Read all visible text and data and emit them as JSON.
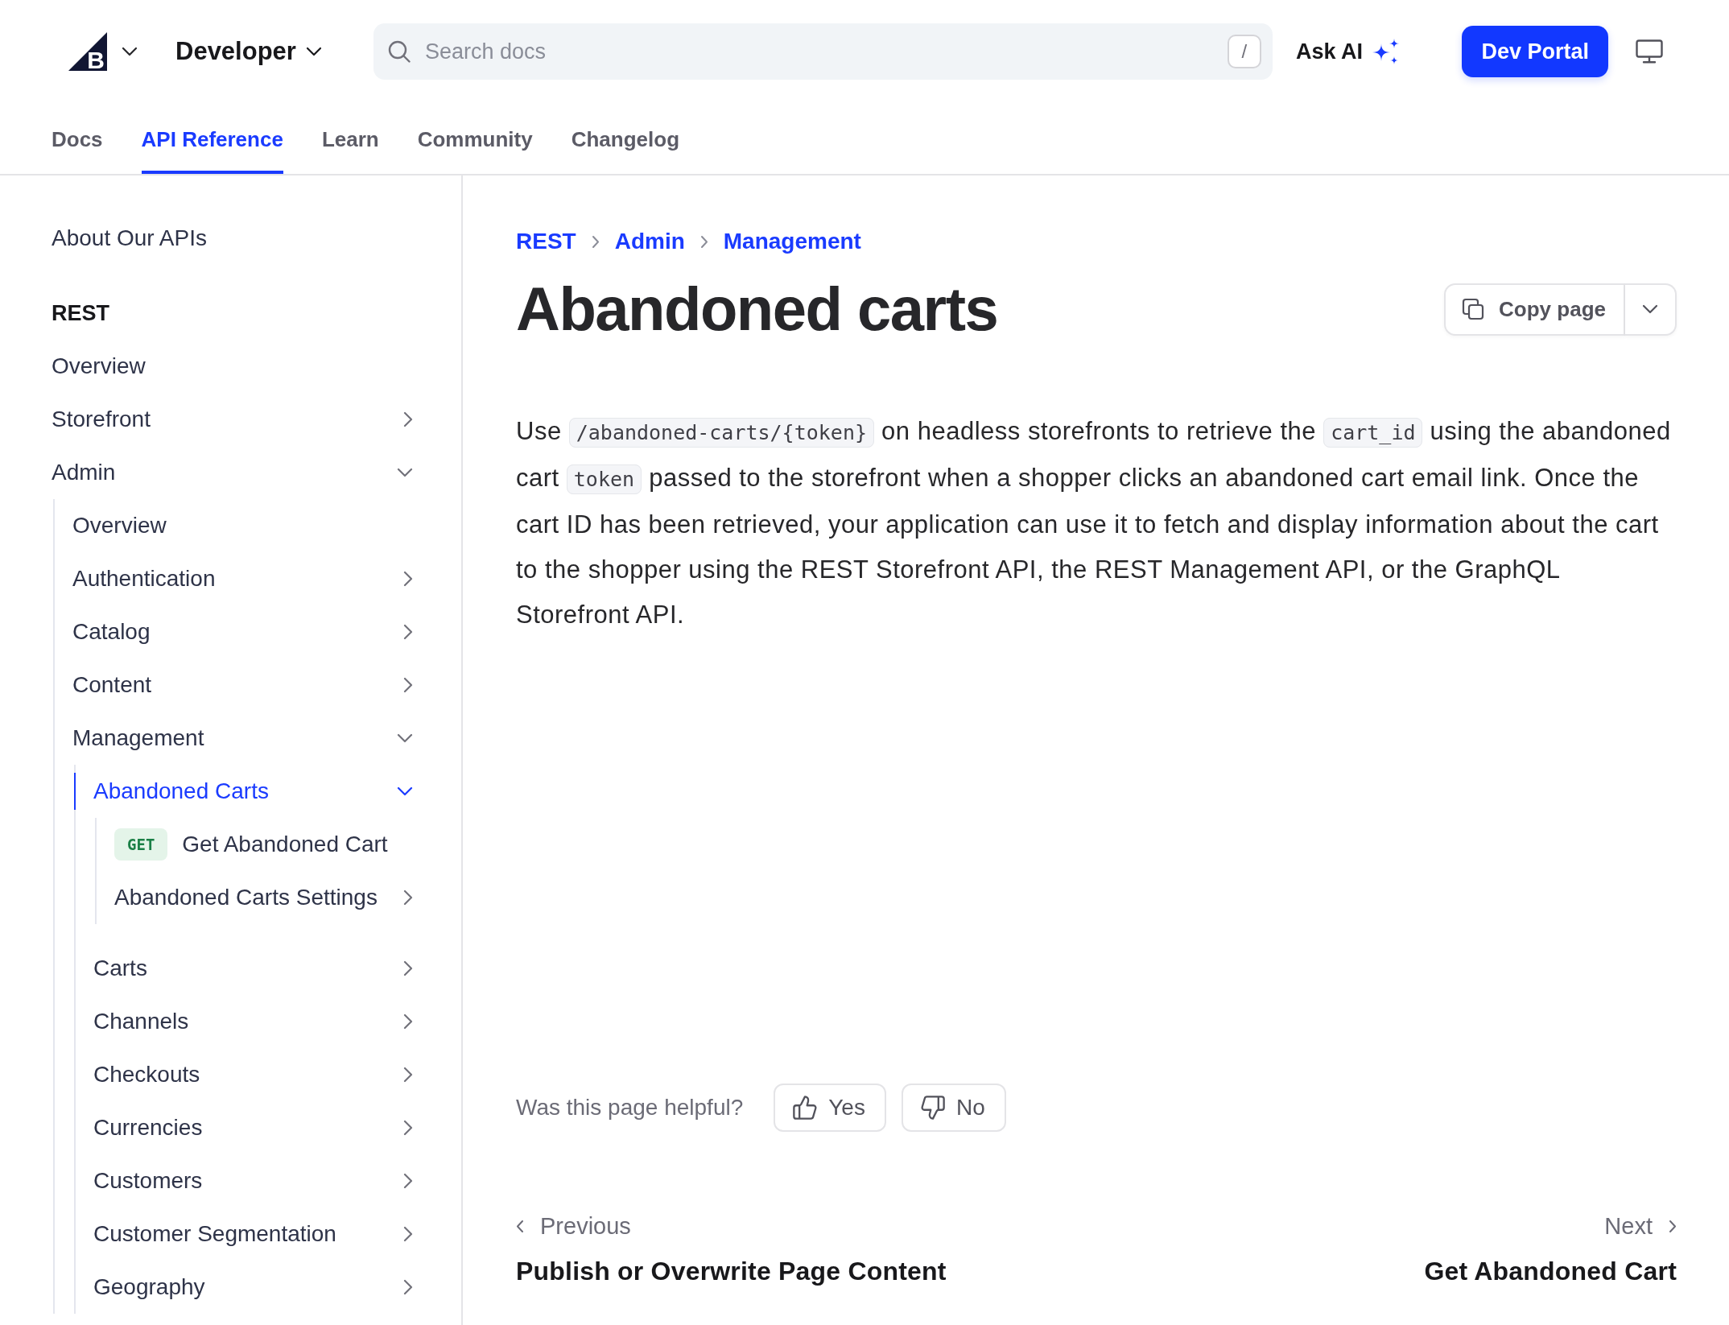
{
  "header": {
    "brand": {
      "letter": "B"
    },
    "product": "Developer",
    "search": {
      "placeholder": "Search docs",
      "shortcut": "/"
    },
    "ask_ai": "Ask AI",
    "dev_portal": "Dev Portal"
  },
  "tabs": [
    {
      "label": "Docs",
      "selected": false
    },
    {
      "label": "API Reference",
      "selected": true
    },
    {
      "label": "Learn",
      "selected": false
    },
    {
      "label": "Community",
      "selected": false
    },
    {
      "label": "Changelog",
      "selected": false
    }
  ],
  "sidebar": {
    "items": [
      {
        "kind": "link",
        "label": "About Our APIs",
        "selected": false
      },
      {
        "kind": "heading",
        "label": "REST"
      },
      {
        "kind": "link",
        "label": "Overview",
        "selected": false
      },
      {
        "kind": "group",
        "label": "Storefront",
        "expanded": false,
        "selected": false
      },
      {
        "kind": "group",
        "label": "Admin",
        "expanded": true,
        "selected": false,
        "children": [
          {
            "kind": "link",
            "label": "Overview",
            "selected": false
          },
          {
            "kind": "group",
            "label": "Authentication",
            "expanded": false,
            "selected": false
          },
          {
            "kind": "group",
            "label": "Catalog",
            "expanded": false,
            "selected": false
          },
          {
            "kind": "group",
            "label": "Content",
            "expanded": false,
            "selected": false
          },
          {
            "kind": "group",
            "label": "Management",
            "expanded": true,
            "selected": false,
            "children": [
              {
                "kind": "group",
                "label": "Abandoned Carts",
                "expanded": true,
                "selected": true,
                "children": [
                  {
                    "kind": "endpoint",
                    "method": "GET",
                    "label": "Get Abandoned Cart",
                    "selected": false
                  },
                  {
                    "kind": "group",
                    "label": "Abandoned Carts Settings",
                    "expanded": false,
                    "selected": false
                  }
                ]
              },
              {
                "kind": "group",
                "label": "Carts",
                "expanded": false,
                "selected": false
              },
              {
                "kind": "group",
                "label": "Channels",
                "expanded": false,
                "selected": false
              },
              {
                "kind": "group",
                "label": "Checkouts",
                "expanded": false,
                "selected": false
              },
              {
                "kind": "group",
                "label": "Currencies",
                "expanded": false,
                "selected": false
              },
              {
                "kind": "group",
                "label": "Customers",
                "expanded": false,
                "selected": false
              },
              {
                "kind": "group",
                "label": "Customer Segmentation",
                "expanded": false,
                "selected": false
              },
              {
                "kind": "group",
                "label": "Geography",
                "expanded": false,
                "selected": false
              }
            ]
          }
        ]
      }
    ]
  },
  "page": {
    "breadcrumbs": [
      "REST",
      "Admin",
      "Management"
    ],
    "title": "Abandoned carts",
    "copy_button": "Copy page",
    "body": [
      {
        "kind": "text",
        "text": "Use "
      },
      {
        "kind": "code",
        "text": "/abandoned-carts/{token}"
      },
      {
        "kind": "text",
        "text": " on headless storefronts to retrieve the "
      },
      {
        "kind": "code",
        "text": "cart_id"
      },
      {
        "kind": "text",
        "text": " using the abandoned cart "
      },
      {
        "kind": "code",
        "text": "token"
      },
      {
        "kind": "text",
        "text": " passed to the storefront when a shopper clicks an abandoned cart email link. Once the cart ID has been retrieved, your application can use it to fetch and display information about the cart to the shopper using the REST Storefront API, the REST Management API, or the GraphQL Storefront API."
      }
    ]
  },
  "feedback": {
    "question": "Was this page helpful?",
    "yes": "Yes",
    "no": "No"
  },
  "pagination": {
    "previous": {
      "label": "Previous",
      "title": "Publish or Overwrite Page Content"
    },
    "next": {
      "label": "Next",
      "title": "Get Abandoned Cart"
    }
  }
}
